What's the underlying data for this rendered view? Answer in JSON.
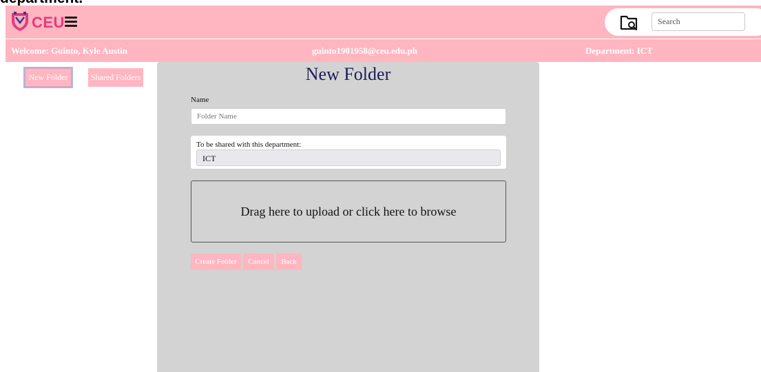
{
  "page_heading": "department.",
  "header": {
    "logo_text": "CEU",
    "search": {
      "placeholder": "Search",
      "value": ""
    }
  },
  "user_bar": {
    "welcome": "Welcome: Guinto, Kyle Austin",
    "email": "guinto1901958@ceu.edu.ph",
    "department": "Department: ICT"
  },
  "sidebar": {
    "new_folder": "New Folder",
    "shared_folders": "Shared Folders"
  },
  "form": {
    "title": "New Folder",
    "name_label": "Name",
    "name_placeholder": "Folder Name",
    "share_label": "To be shared with this department:",
    "share_value": "ICT",
    "dropzone_text": "Drag here to upload or click here to browse",
    "buttons": {
      "create": "Create Folder",
      "cancel": "Cancel",
      "back": "Back"
    }
  },
  "colors": {
    "header_bg": "#ffb6c1",
    "panel_bg": "#d3d3d3",
    "logo_pink": "#e8397b",
    "title_navy": "#1c1c5a"
  },
  "icons": {
    "logo": "ceu-shield-logo-icon",
    "menu": "hamburger-menu-icon",
    "search": "folder-search-icon"
  }
}
